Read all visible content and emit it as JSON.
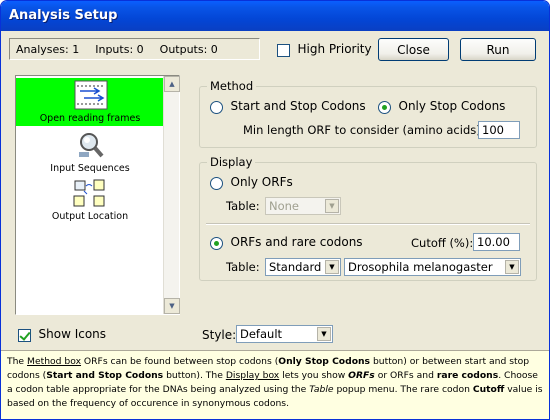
{
  "window": {
    "title": "Analysis Setup"
  },
  "status": {
    "analyses": "Analyses: 1",
    "inputs": "Inputs: 0",
    "outputs": "Outputs: 0"
  },
  "toolbar": {
    "high_priority_label": "High Priority",
    "high_priority_checked": false,
    "close_label": "Close",
    "run_label": "Run"
  },
  "workflow": {
    "items": [
      {
        "label": "Open reading frames",
        "icon": "orf-icon",
        "selected": true
      },
      {
        "label": "Input Sequences",
        "icon": "magnifier-icon",
        "selected": false
      },
      {
        "label": "Output Location",
        "icon": "output-folders-icon",
        "selected": false
      }
    ]
  },
  "method": {
    "title": "Method",
    "option1": "Start and Stop Codons",
    "option2": "Only Stop Codons",
    "selected": "option2",
    "minlen_label": "Min length ORF to consider (amino acids):",
    "minlen_value": "100"
  },
  "display": {
    "title": "Display",
    "only_orfs_label": "Only ORFs",
    "table_label": "Table:",
    "table1_value": "None",
    "orfs_rare_label": "ORFs and rare codons",
    "cutoff_label": "Cutoff (%):",
    "cutoff_value": "10.00",
    "table2_label": "Table:",
    "table2_value": "Standard",
    "organism_value": "Drosophila melanogaster",
    "selected": "orfs_rare"
  },
  "bottom": {
    "show_icons_label": "Show Icons",
    "show_icons_checked": true,
    "style_label": "Style:",
    "style_value": "Default"
  },
  "help": {
    "p1": "The ",
    "method_box": "Method box",
    "p2": " ORFs can be found between stop codons (",
    "only_stop": "Only Stop Codons",
    "p3": " button) or between start and stop codons (",
    "start_stop": "Start and Stop Codons",
    "p4": " button). The ",
    "display_box": "Display box",
    "p5": " lets you show ",
    "orfs": "ORFs",
    "p6": " or ORFs and ",
    "rare": "rare codons",
    "p7": ". Choose a codon table appropriate for the DNAs being analyzed using the ",
    "table": "Table",
    "p8": " popup menu. The rare codon ",
    "cutoff": "Cutoff",
    "p9": " value is based on the frequency of occurence in synonymous codons."
  },
  "colors": {
    "selected_bg": "#00ff00",
    "titlebar": "#0a5fff",
    "help_bg": "#ffffe1"
  }
}
